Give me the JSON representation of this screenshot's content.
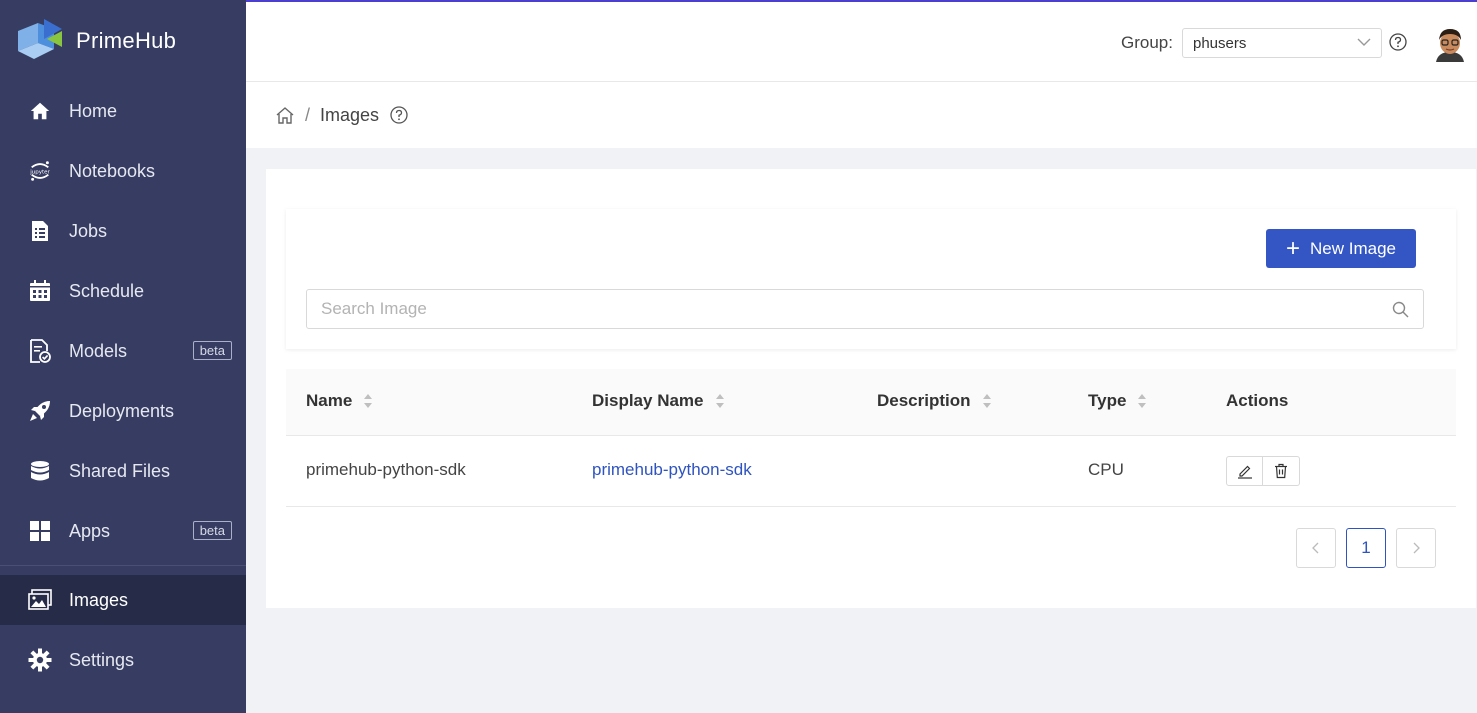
{
  "app": {
    "name": "PrimeHub"
  },
  "sidebar": {
    "items": [
      {
        "label": "Home",
        "icon": "home-icon"
      },
      {
        "label": "Notebooks",
        "icon": "jupyter-icon"
      },
      {
        "label": "Jobs",
        "icon": "jobs-icon"
      },
      {
        "label": "Schedule",
        "icon": "calendar-icon"
      },
      {
        "label": "Models",
        "icon": "models-icon",
        "badge": "beta"
      },
      {
        "label": "Deployments",
        "icon": "rocket-icon"
      },
      {
        "label": "Shared Files",
        "icon": "database-icon"
      },
      {
        "label": "Apps",
        "icon": "apps-icon",
        "badge": "beta"
      },
      {
        "label": "Images",
        "icon": "image-icon",
        "active": true
      },
      {
        "label": "Settings",
        "icon": "gear-icon"
      }
    ]
  },
  "header": {
    "group_label": "Group:",
    "group_value": "phusers"
  },
  "breadcrumb": {
    "separator": "/",
    "current": "Images"
  },
  "toolbar": {
    "new_button_label": "New Image",
    "search_placeholder": "Search Image"
  },
  "table": {
    "columns": [
      "Name",
      "Display Name",
      "Description",
      "Type",
      "Actions"
    ],
    "rows": [
      {
        "name": "primehub-python-sdk",
        "display_name": "primehub-python-sdk",
        "description": "",
        "type": "CPU"
      }
    ]
  },
  "pagination": {
    "current_page": "1"
  },
  "colors": {
    "sidebar_bg": "#373d62",
    "sidebar_active_bg": "#262b47",
    "primary": "#3456c4",
    "link": "#2f54c0"
  }
}
